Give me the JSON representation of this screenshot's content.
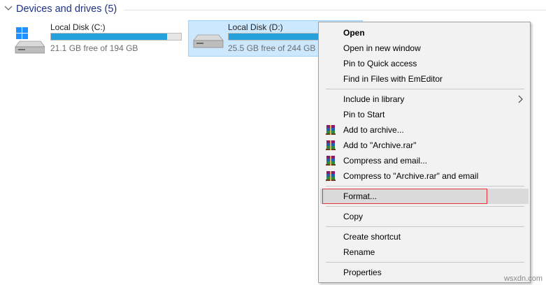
{
  "group": {
    "title": "Devices and drives (5)",
    "icon": "chevron-down-icon"
  },
  "drives": [
    {
      "label": "Local Disk (C:)",
      "free": "21.1 GB free of 194 GB",
      "used_fraction": 0.89,
      "icon": "windows-drive-icon"
    },
    {
      "label": "Local Disk (D:)",
      "free": "25.5 GB free of 244 GB",
      "used_fraction": 0.9,
      "icon": "hard-drive-icon",
      "selected": true
    }
  ],
  "context_menu": {
    "items": [
      {
        "label": "Open",
        "bold": true
      },
      {
        "label": "Open in new window"
      },
      {
        "label": "Pin to Quick access"
      },
      {
        "label": "Find in Files with EmEditor"
      },
      {
        "label": "Include in library",
        "submenu": true
      },
      {
        "label": "Pin to Start"
      },
      {
        "label": "Add to archive...",
        "icon": "winrar-icon"
      },
      {
        "label": "Add to \"Archive.rar\"",
        "icon": "winrar-icon"
      },
      {
        "label": "Compress and email...",
        "icon": "winrar-icon"
      },
      {
        "label": "Compress to \"Archive.rar\" and email",
        "icon": "winrar-icon"
      },
      {
        "label": "Format...",
        "highlighted": true
      },
      {
        "label": "Copy"
      },
      {
        "label": "Create shortcut"
      },
      {
        "label": "Rename"
      },
      {
        "label": "Properties"
      }
    ]
  },
  "colors": {
    "accent": "#26a0da",
    "selection": "#cce8ff",
    "highlight_border": "#e0323c",
    "group_title": "#1e3287"
  },
  "watermark": "wsxdn.com"
}
